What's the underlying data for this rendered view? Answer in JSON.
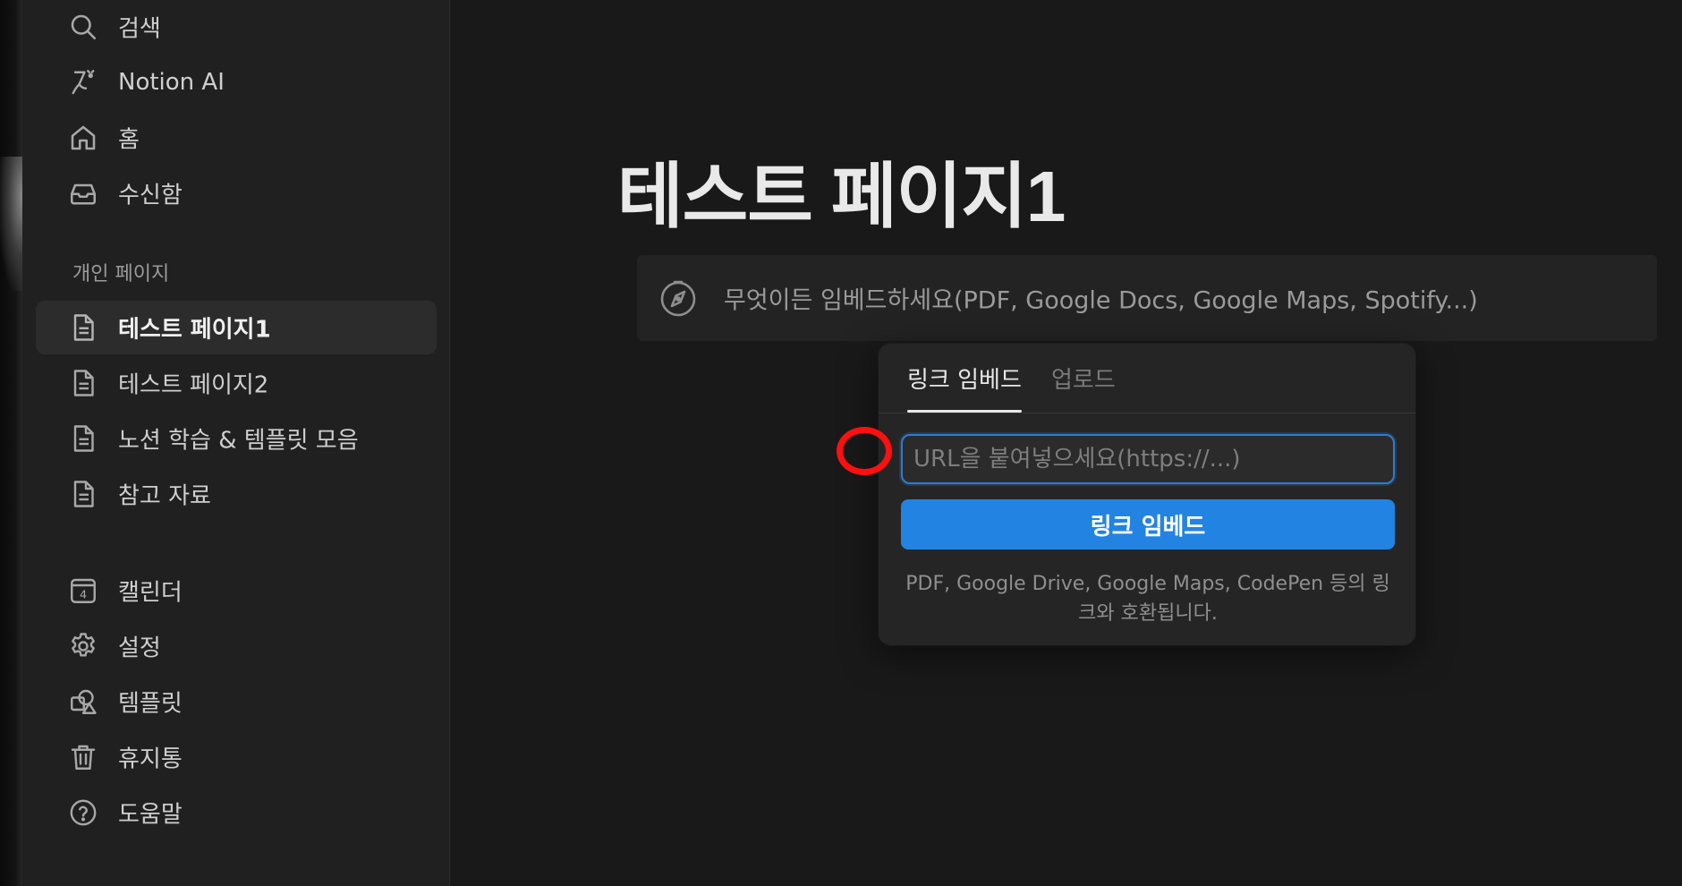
{
  "sidebar": {
    "top_items": [
      {
        "label": "검색",
        "icon": "search-icon"
      },
      {
        "label": "Notion AI",
        "icon": "notion-ai-icon"
      },
      {
        "label": "홈",
        "icon": "home-icon"
      },
      {
        "label": "수신함",
        "icon": "inbox-icon"
      }
    ],
    "section_label": "개인 페이지",
    "pages": [
      {
        "label": "테스트 페이지1",
        "icon": "page-icon",
        "active": true
      },
      {
        "label": "테스트 페이지2",
        "icon": "page-icon"
      },
      {
        "label": "노션 학습 & 템플릿 모음",
        "icon": "page-icon"
      },
      {
        "label": "참고 자료",
        "icon": "page-icon"
      }
    ],
    "bottom_items": [
      {
        "label": "캘린더",
        "icon": "calendar-icon",
        "icon_text": "4"
      },
      {
        "label": "설정",
        "icon": "gear-icon"
      },
      {
        "label": "템플릿",
        "icon": "template-icon"
      },
      {
        "label": "휴지통",
        "icon": "trash-icon"
      },
      {
        "label": "도움말",
        "icon": "help-icon"
      }
    ]
  },
  "main": {
    "page_title": "테스트 페이지1",
    "embed_block": {
      "icon": "compass-icon",
      "text": "무엇이든 임베드하세요(PDF, Google Docs, Google Maps, Spotify...)"
    }
  },
  "popover": {
    "tabs": [
      {
        "label": "링크 임베드",
        "active": true
      },
      {
        "label": "업로드",
        "active": false
      }
    ],
    "url_input": {
      "placeholder": "URL을 붙여넣으세요(https://...)",
      "value": ""
    },
    "button_label": "링크 임베드",
    "helper_text": "PDF, Google Drive, Google Maps, CodePen 등의 링크와 호환됩니다."
  },
  "colors": {
    "background": "#191919",
    "sidebar": "#202020",
    "accent": "#2383e2",
    "annotation": "#ff1010"
  }
}
